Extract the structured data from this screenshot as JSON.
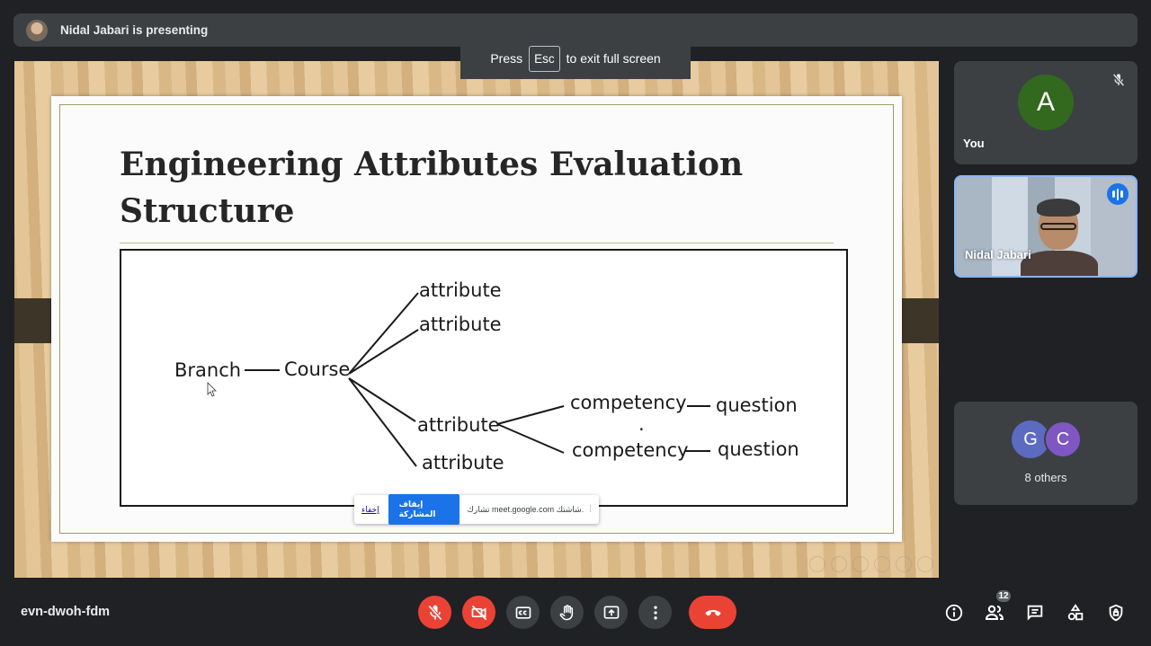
{
  "banner": {
    "presenter_text": "Nidal Jabari is presenting"
  },
  "toast": {
    "press": "Press",
    "key": "Esc",
    "rest": "to exit full screen"
  },
  "slide": {
    "title_line1": "Engineering Attributes Evaluation",
    "title_line2": "Structure",
    "diagram": {
      "branch": "Branch",
      "course": "Course",
      "attribute_1": "attribute",
      "attribute_2": "attribute",
      "attribute_3": "attribute",
      "attribute_4": "attribute",
      "competency_1": "competency",
      "competency_2": "competency",
      "dot": ".",
      "question_1": "question",
      "question_2": "question"
    }
  },
  "sharebar": {
    "hide_label": "إخفاء",
    "stop_label": "إيقاف المشاركة",
    "message": "تشارك meet.google.com شاشتك."
  },
  "tiles": {
    "you": {
      "initial": "A",
      "name": "You",
      "avatar_color": "#33691e"
    },
    "nidal": {
      "name": "Nidal Jabari"
    },
    "others": {
      "initial_1": "G",
      "initial_2": "C",
      "label": "8 others"
    }
  },
  "bottom": {
    "meeting_code": "evn-dwoh-fdm",
    "participants_count": "12"
  },
  "colors": {
    "danger": "#ea4335",
    "speaking": "#1a73e8",
    "surface": "#3c4043",
    "background": "#202124"
  },
  "icons": {
    "mic_off": "mic-off-icon",
    "camera_off": "camera-off-icon",
    "captions": "captions-icon",
    "hand": "raise-hand-icon",
    "present": "present-icon",
    "more": "more-vert-icon",
    "hangup": "hangup-icon",
    "info": "info-icon",
    "people": "people-icon",
    "chat": "chat-icon",
    "activities": "activities-icon",
    "host": "host-controls-icon"
  }
}
